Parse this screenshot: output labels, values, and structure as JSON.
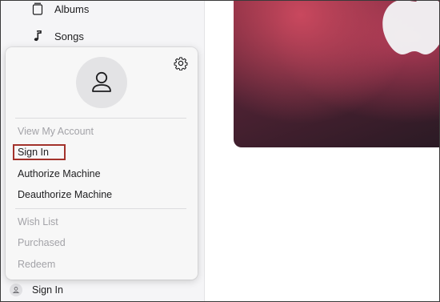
{
  "sidebar": {
    "items": [
      {
        "label": "Albums",
        "icon": "album-icon"
      },
      {
        "label": "Songs",
        "icon": "music-note-icon"
      }
    ],
    "account_button": {
      "label": "Sign In",
      "icon": "person-icon"
    }
  },
  "account_popover": {
    "avatar_icon": "person-icon",
    "settings_icon": "gear-icon",
    "items": [
      {
        "label": "View My Account",
        "enabled": false
      },
      {
        "label": "Sign In",
        "enabled": true,
        "highlighted": true
      },
      {
        "label": "Authorize Machine",
        "enabled": true
      },
      {
        "label": "Deauthorize Machine",
        "enabled": true
      },
      {
        "label": "Wish List",
        "enabled": false
      },
      {
        "label": "Purchased",
        "enabled": false
      },
      {
        "label": "Redeem",
        "enabled": false
      }
    ]
  },
  "colors": {
    "highlight_border": "#a3322b",
    "disabled_text": "#a3a3a8",
    "enabled_text": "#1d1d1f",
    "hero_accent": "#c9485e"
  }
}
